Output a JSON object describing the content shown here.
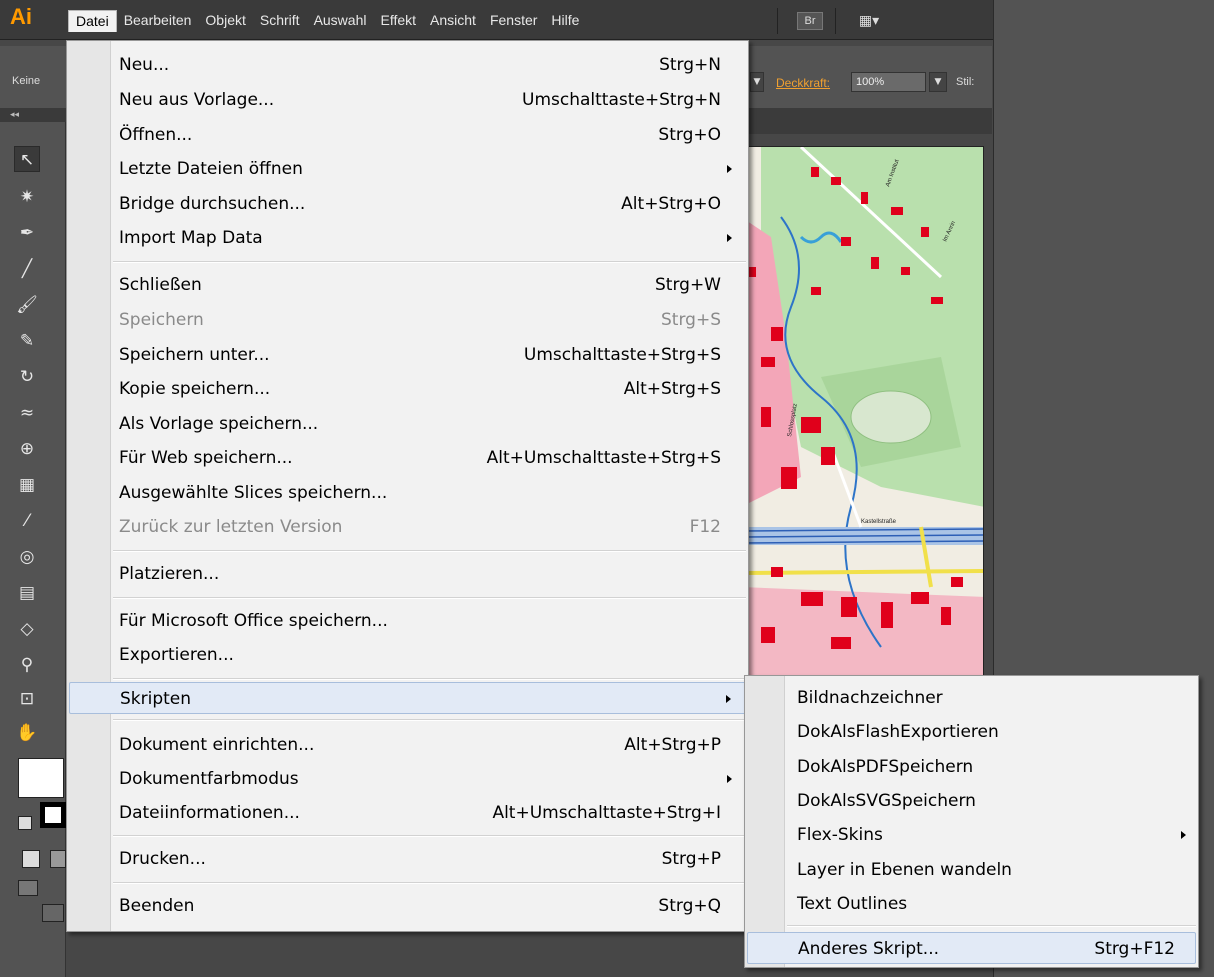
{
  "app": {
    "logo": "Ai"
  },
  "menubar": {
    "items": [
      "Datei",
      "Bearbeiten",
      "Objekt",
      "Schrift",
      "Auswahl",
      "Effekt",
      "Ansicht",
      "Fenster",
      "Hilfe"
    ],
    "bridge_button": "Br",
    "arrange_icon": "▦▾"
  },
  "controlbar": {
    "fill_label": "Keine",
    "opacity_label": "Deckkraft:",
    "opacity_value": "100%",
    "style_label": "Stil:",
    "accent_color": "#f0a030"
  },
  "datei_menu": {
    "items": [
      {
        "label": "Neu...",
        "shortcut": "Strg+N"
      },
      {
        "label": "Neu aus Vorlage...",
        "shortcut": "Umschalttaste+Strg+N"
      },
      {
        "label": "Öffnen...",
        "shortcut": "Strg+O"
      },
      {
        "label": "Letzte Dateien öffnen",
        "shortcut": "",
        "submenu": true
      },
      {
        "label": "Bridge durchsuchen...",
        "shortcut": "Alt+Strg+O"
      },
      {
        "label": "Import Map Data",
        "shortcut": "",
        "submenu": true
      },
      {
        "label": "Schließen",
        "shortcut": "Strg+W"
      },
      {
        "label": "Speichern",
        "shortcut": "Strg+S",
        "disabled": true
      },
      {
        "label": "Speichern unter...",
        "shortcut": "Umschalttaste+Strg+S"
      },
      {
        "label": "Kopie speichern...",
        "shortcut": "Alt+Strg+S"
      },
      {
        "label": "Als Vorlage speichern...",
        "shortcut": ""
      },
      {
        "label": "Für Web speichern...",
        "shortcut": "Alt+Umschalttaste+Strg+S"
      },
      {
        "label": "Ausgewählte Slices speichern...",
        "shortcut": ""
      },
      {
        "label": "Zurück zur letzten Version",
        "shortcut": "F12",
        "disabled": true
      },
      {
        "label": "Platzieren...",
        "shortcut": ""
      },
      {
        "label": "Für Microsoft Office speichern...",
        "shortcut": ""
      },
      {
        "label": "Exportieren...",
        "shortcut": ""
      },
      {
        "label": "Skripten",
        "shortcut": "",
        "submenu": true,
        "highlighted": true
      },
      {
        "label": "Dokument einrichten...",
        "shortcut": "Alt+Strg+P"
      },
      {
        "label": "Dokumentfarbmodus",
        "shortcut": "",
        "submenu": true
      },
      {
        "label": "Dateiinformationen...",
        "shortcut": "Alt+Umschalttaste+Strg+I"
      },
      {
        "label": "Drucken...",
        "shortcut": "Strg+P"
      },
      {
        "label": "Beenden",
        "shortcut": "Strg+Q"
      }
    ]
  },
  "skripten_submenu": {
    "items": [
      {
        "label": "Bildnachzeichner",
        "shortcut": ""
      },
      {
        "label": "DokAlsFlashExportieren",
        "shortcut": ""
      },
      {
        "label": "DokAlsPDFSpeichern",
        "shortcut": ""
      },
      {
        "label": "DokAlsSVGSpeichern",
        "shortcut": ""
      },
      {
        "label": "Flex-Skins",
        "shortcut": "",
        "submenu": true
      },
      {
        "label": "Layer in Ebenen wandeln",
        "shortcut": ""
      },
      {
        "label": "Text Outlines",
        "shortcut": ""
      },
      {
        "label": "Anderes Skript...",
        "shortcut": "Strg+F12",
        "highlighted": true
      }
    ]
  },
  "map": {
    "labels": [
      "Am Institut",
      "Im Anrin",
      "Kastellstraße",
      "Schlossplatz"
    ]
  },
  "colors": {
    "app_bg": "#474747",
    "menu_bg": "#f2f2f2",
    "highlight": "#e2eaf6",
    "brand": "#ff9a00"
  }
}
